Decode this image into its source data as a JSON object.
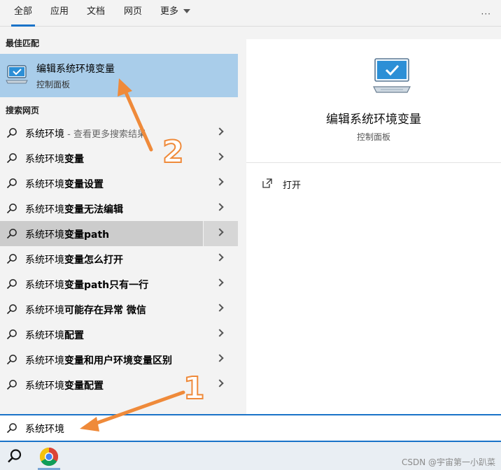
{
  "tabs": [
    {
      "label": "全部",
      "active": true
    },
    {
      "label": "应用",
      "active": false
    },
    {
      "label": "文档",
      "active": false
    },
    {
      "label": "网页",
      "active": false
    },
    {
      "label": "更多",
      "active": false
    }
  ],
  "more_options_label": "···",
  "sections": {
    "best_match": "最佳匹配",
    "web_search": "搜索网页"
  },
  "best_match": {
    "icon": "monitor-check-icon",
    "title": "编辑系统环境变量",
    "subtitle": "控制面板"
  },
  "results": [
    {
      "prefix": "系统环境",
      "bold": "",
      "suffix": " - 查看更多搜索结果"
    },
    {
      "prefix": "系统环境",
      "bold": "变量",
      "suffix": ""
    },
    {
      "prefix": "系统环境",
      "bold": "变量设置",
      "suffix": ""
    },
    {
      "prefix": "系统环境",
      "bold": "变量无法编辑",
      "suffix": ""
    },
    {
      "prefix": "系统环境",
      "bold": "变量path",
      "suffix": "",
      "selected": true
    },
    {
      "prefix": "系统环境",
      "bold": "变量怎么打开",
      "suffix": ""
    },
    {
      "prefix": "系统环境",
      "bold": "变量path只有一行",
      "suffix": ""
    },
    {
      "prefix": "系统环境",
      "bold": "可能存在异常 微信",
      "suffix": ""
    },
    {
      "prefix": "系统环境",
      "bold": "配置",
      "suffix": ""
    },
    {
      "prefix": "系统环境",
      "bold": "变量和用户环境变量区别",
      "suffix": ""
    },
    {
      "prefix": "系统环境",
      "bold": "变量配置",
      "suffix": ""
    }
  ],
  "detail": {
    "title": "编辑系统环境变量",
    "subtitle": "控制面板",
    "action_open": "打开"
  },
  "search": {
    "value": "系统环境"
  },
  "taskbar": {
    "watermark": "CSDN @宇宙第一小趴菜"
  },
  "annotations": {
    "step1": "1",
    "step2": "2",
    "color": "#ef8a3a"
  },
  "colors": {
    "accent": "#1a73c8",
    "best_match_bg": "#a9cdea",
    "selected_bg": "#cccccc"
  }
}
